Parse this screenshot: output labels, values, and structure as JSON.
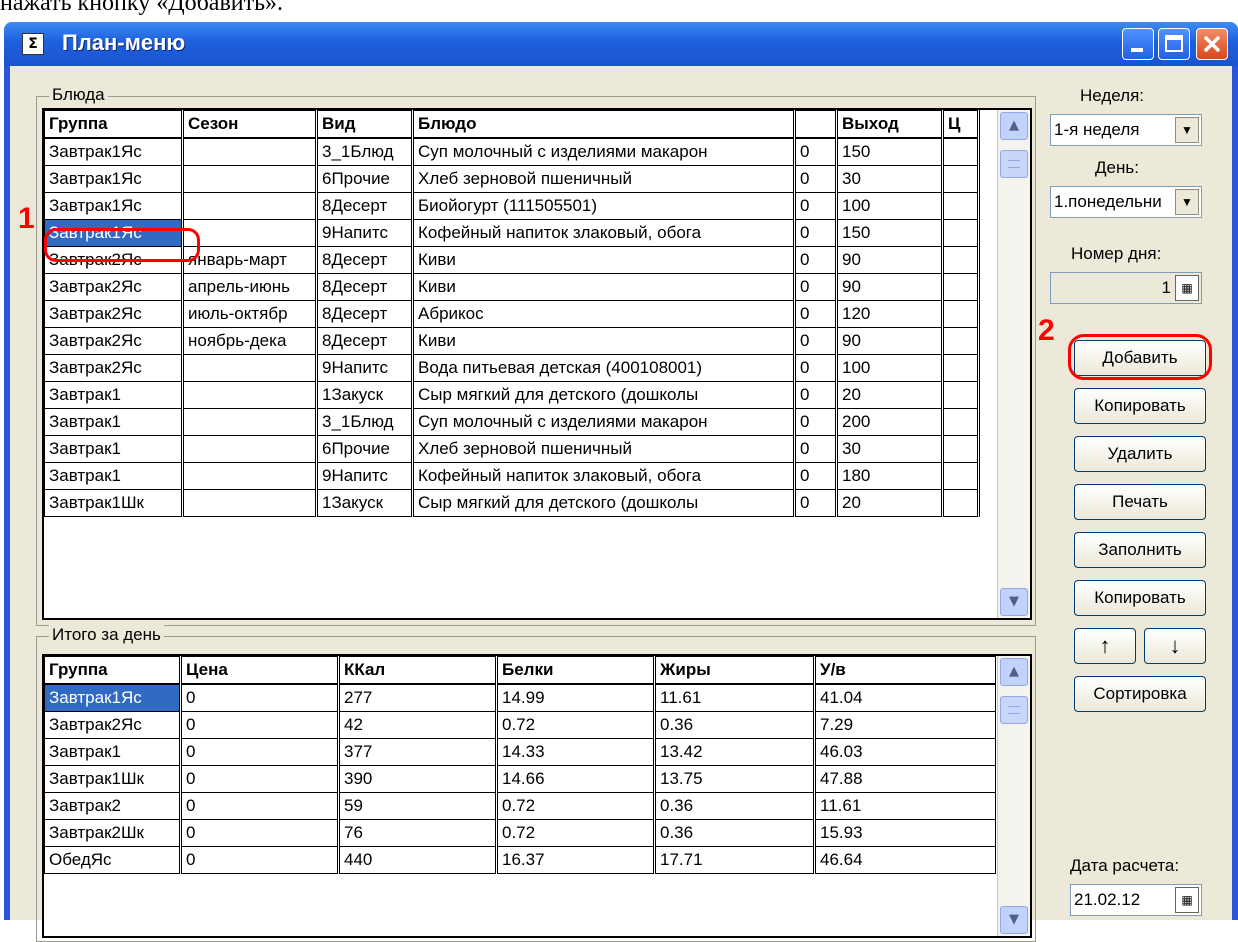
{
  "top_text": "нажать кнопку «Добавить».",
  "window": {
    "title": "План-меню",
    "icon_glyph": "Σ"
  },
  "dishes": {
    "group_label": "Блюда",
    "columns": [
      "Группа",
      "Сезон",
      "Вид",
      "Блюдо",
      "",
      "Выход",
      "Ц"
    ],
    "rows": [
      [
        "Завтрак1Яс",
        "",
        "3_1Блюд",
        "Суп молочный с изделиями макарон",
        "0",
        "150"
      ],
      [
        "Завтрак1Яс",
        "",
        "6Прочие",
        "Хлеб зерновой пшеничный",
        "0",
        "30"
      ],
      [
        "Завтрак1Яс",
        "",
        "8Десерт",
        "Биойогурт (111505501)",
        "0",
        "100"
      ],
      [
        "Завтрак1Яс",
        "",
        "9Напитс",
        "Кофейный напиток злаковый, обога",
        "0",
        "150"
      ],
      [
        "Завтрак2Яс",
        "январь-март",
        "8Десерт",
        "Киви",
        "0",
        "90"
      ],
      [
        "Завтрак2Яс",
        "апрель-июнь",
        "8Десерт",
        "Киви",
        "0",
        "90"
      ],
      [
        "Завтрак2Яс",
        "июль-октябр",
        "8Десерт",
        "Абрикос",
        "0",
        "120"
      ],
      [
        "Завтрак2Яс",
        "ноябрь-дека",
        "8Десерт",
        "Киви",
        "0",
        "90"
      ],
      [
        "Завтрак2Яс",
        "",
        "9Напитс",
        "Вода питьевая детская (400108001)",
        "0",
        "100"
      ],
      [
        "Завтрак1",
        "",
        "1Закуск",
        "Сыр мягкий для детского (дошколы",
        "0",
        "20"
      ],
      [
        "Завтрак1",
        "",
        "3_1Блюд",
        "Суп молочный с изделиями макарон",
        "0",
        "200"
      ],
      [
        "Завтрак1",
        "",
        "6Прочие",
        "Хлеб зерновой пшеничный",
        "0",
        "30"
      ],
      [
        "Завтрак1",
        "",
        "9Напитс",
        "Кофейный напиток злаковый, обога",
        "0",
        "180"
      ],
      [
        "Завтрак1Шк",
        "",
        "1Закуск",
        "Сыр мягкий для детского (дошколы",
        "0",
        "20"
      ]
    ]
  },
  "totals": {
    "group_label": "Итого за день",
    "columns": [
      "Группа",
      "Цена",
      "ККал",
      "Белки",
      "Жиры",
      "У/в"
    ],
    "rows": [
      [
        "Завтрак1Яс",
        "0",
        "277",
        "14.99",
        "11.61",
        "41.04"
      ],
      [
        "Завтрак2Яс",
        "0",
        "42",
        "0.72",
        "0.36",
        "7.29"
      ],
      [
        "Завтрак1",
        "0",
        "377",
        "14.33",
        "13.42",
        "46.03"
      ],
      [
        "Завтрак1Шк",
        "0",
        "390",
        "14.66",
        "13.75",
        "47.88"
      ],
      [
        "Завтрак2",
        "0",
        "59",
        "0.72",
        "0.36",
        "11.61"
      ],
      [
        "Завтрак2Шк",
        "0",
        "76",
        "0.72",
        "0.36",
        "15.93"
      ],
      [
        "ОбедЯс",
        "0",
        "440",
        "16.37",
        "17.71",
        "46.64"
      ]
    ]
  },
  "sidebar": {
    "week_label": "Неделя:",
    "week_value": "1-я неделя",
    "day_label": "День:",
    "day_value": "1.понедельни",
    "day_number_label": "Номер дня:",
    "day_number_value": "1",
    "buttons": {
      "add": "Добавить",
      "copy": "Копировать",
      "delete": "Удалить",
      "print": "Печать",
      "fill": "Заполнить",
      "copy2": "Копировать",
      "up": "↑",
      "down": "↓",
      "sort": "Сортировка"
    },
    "calc_date_label": "Дата расчета:",
    "calc_date_value": "21.02.12"
  },
  "annotations": {
    "marker1": "1",
    "marker2": "2",
    "color": "#ff0000"
  },
  "colors": {
    "title_bar": "#1d5fdd",
    "selection": "#316ac5",
    "client": "#ece9d8"
  }
}
